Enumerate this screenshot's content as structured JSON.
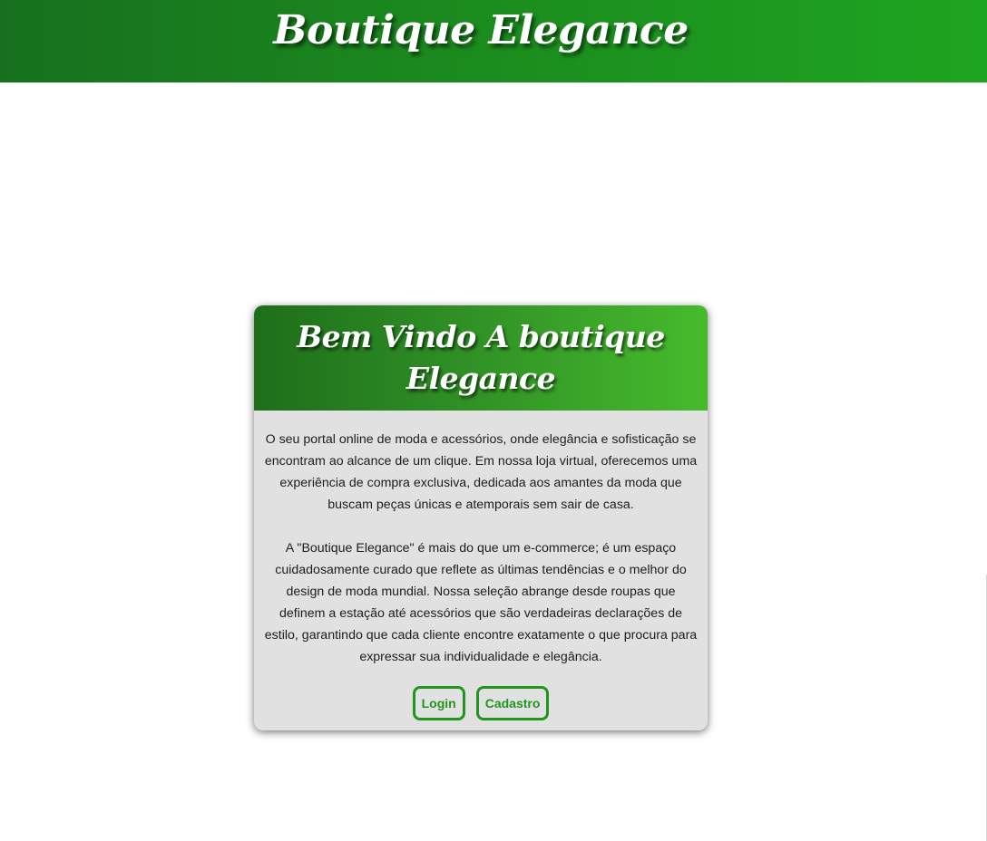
{
  "header": {
    "title": "Boutique Elegance"
  },
  "card": {
    "title": "Bem Vindo A boutique Elegance",
    "paragraphs": [
      "O seu portal online de moda e acessórios, onde elegância e sofisticação se encontram ao alcance de um clique. Em nossa loja virtual, oferecemos uma experiência de compra exclusiva, dedicada aos amantes da moda que buscam peças únicas e atemporais sem sair de casa.",
      "A \"Boutique Elegance\" é mais do que um e-commerce; é um espaço cuidadosamente curado que reflete as últimas tendências e o melhor do design de moda mundial. Nossa seleção abrange desde roupas que definem a estação até acessórios que são verdadeiras declarações de estilo, garantindo que cada cliente encontre exatamente o que procura para expressar sua individualidade e elegância."
    ],
    "buttons": {
      "login_label": "Login",
      "register_label": "Cadastro"
    }
  },
  "colors": {
    "header_green": "#1b8a1e",
    "card_header_green": "#2f8f25",
    "button_green": "#22951f",
    "card_background": "#e1e1e1"
  }
}
